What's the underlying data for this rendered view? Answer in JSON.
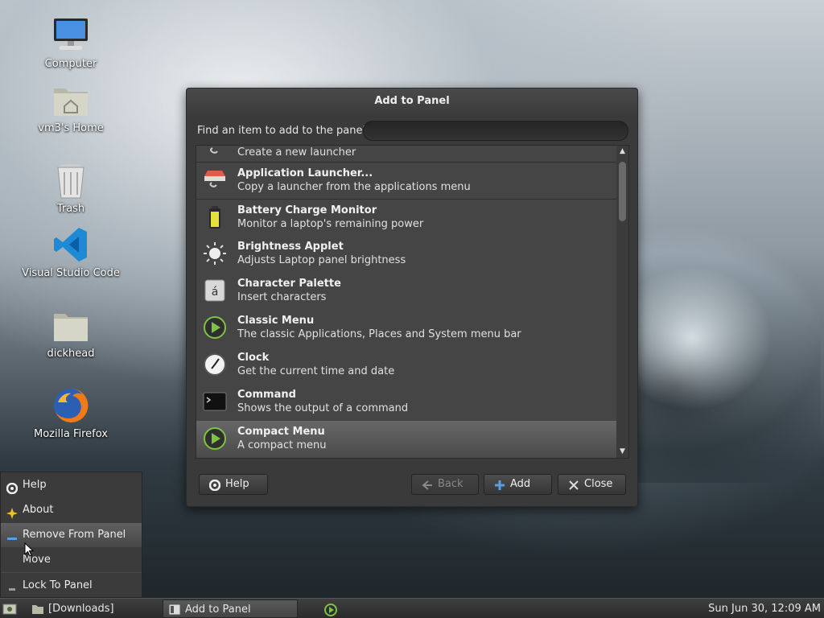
{
  "desktop": {
    "icons": [
      {
        "label": "Computer",
        "icon": "computer-icon"
      },
      {
        "label": "vm3's Home",
        "icon": "home-folder-icon"
      },
      {
        "label": "Trash",
        "icon": "trash-icon"
      },
      {
        "label": "Visual Studio Code",
        "icon": "vscode-icon"
      },
      {
        "label": "dickhead",
        "icon": "folder-icon"
      },
      {
        "label": "Mozilla Firefox",
        "icon": "firefox-icon"
      }
    ]
  },
  "dialog": {
    "title": "Add to Panel",
    "search_label": "Find an item to add to the panel:",
    "search_value": "",
    "items": [
      {
        "name": "",
        "desc": "Create a new launcher",
        "icon": "launcher-icon"
      },
      {
        "name": "Application Launcher...",
        "desc": "Copy a launcher from the applications menu",
        "icon": "application-launcher-icon"
      },
      {
        "name": "Battery Charge Monitor",
        "desc": "Monitor a laptop's remaining power",
        "icon": "battery-icon"
      },
      {
        "name": "Brightness Applet",
        "desc": "Adjusts Laptop panel brightness",
        "icon": "brightness-icon"
      },
      {
        "name": "Character Palette",
        "desc": "Insert characters",
        "icon": "character-palette-icon"
      },
      {
        "name": "Classic Menu",
        "desc": "The classic Applications, Places and System menu bar",
        "icon": "classic-menu-icon"
      },
      {
        "name": "Clock",
        "desc": "Get the current time and date",
        "icon": "clock-icon"
      },
      {
        "name": "Command",
        "desc": "Shows the output of a command",
        "icon": "terminal-icon"
      },
      {
        "name": "Compact Menu",
        "desc": "A compact menu",
        "icon": "compact-menu-icon"
      }
    ],
    "selected_index": 8,
    "buttons": {
      "help": "Help",
      "back": "Back",
      "add": "Add",
      "close": "Close"
    }
  },
  "context_menu": {
    "items": [
      {
        "label": "Help",
        "icon": "help-icon"
      },
      {
        "label": "About",
        "icon": "about-icon"
      },
      {
        "label": "Remove From Panel",
        "icon": "remove-icon"
      },
      {
        "label": "Move",
        "icon": ""
      },
      {
        "label": "Lock To Panel",
        "icon": "lock-icon"
      }
    ],
    "active_index": 2
  },
  "taskbar": {
    "tasks": [
      {
        "label": "[Downloads]",
        "icon": "folder-icon"
      },
      {
        "label": "Add to Panel",
        "icon": "window-icon"
      }
    ],
    "clock": "Sun Jun 30, 12:09 AM"
  },
  "colors": {
    "dialog_bg": "#3a3a3a",
    "list_bg": "#454545",
    "accent_green": "#7fc241",
    "add_icon_blue": "#5aa0e0"
  }
}
